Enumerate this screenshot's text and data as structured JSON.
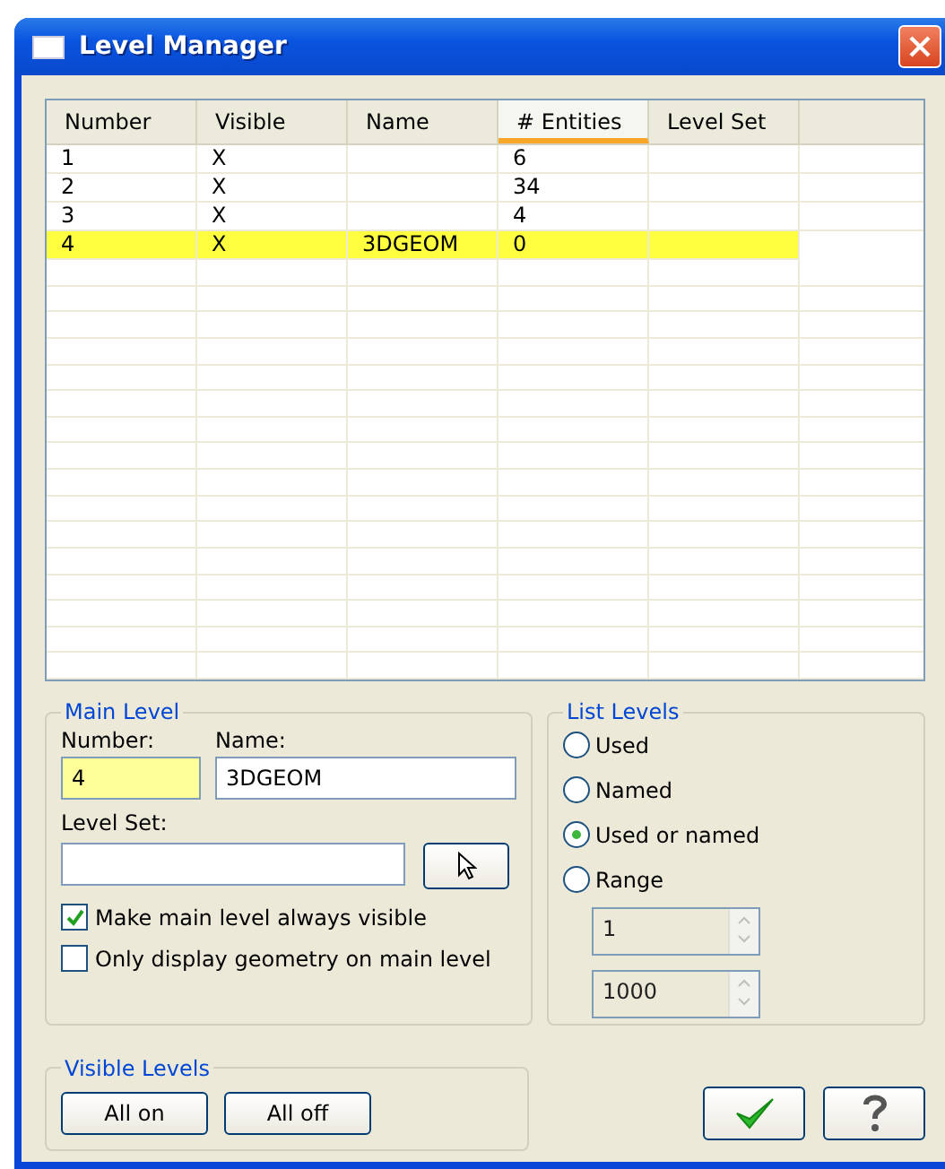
{
  "window": {
    "title": "Level Manager"
  },
  "table": {
    "columns": [
      {
        "label": "Number",
        "sorted": false
      },
      {
        "label": "Visible",
        "sorted": false
      },
      {
        "label": "Name",
        "sorted": false
      },
      {
        "label": "# Entities",
        "sorted": true
      },
      {
        "label": "Level Set",
        "sorted": false
      }
    ],
    "rows": [
      {
        "cells": [
          "1",
          "X",
          "",
          "6",
          ""
        ],
        "selected": false
      },
      {
        "cells": [
          "2",
          "X",
          "",
          "34",
          ""
        ],
        "selected": false
      },
      {
        "cells": [
          "3",
          "X",
          "",
          "4",
          ""
        ],
        "selected": false
      },
      {
        "cells": [
          "4",
          "X",
          "3DGEOM",
          "0",
          ""
        ],
        "selected": true
      }
    ]
  },
  "main_level": {
    "title": "Main Level",
    "number_label": "Number:",
    "number_value": "4",
    "name_label": "Name:",
    "name_value": "3DGEOM",
    "level_set_label": "Level Set:",
    "checkboxes": [
      {
        "label": "Make main level always visible",
        "checked": true
      },
      {
        "label": "Only display geometry on main level",
        "checked": false
      }
    ]
  },
  "list_levels": {
    "title": "List Levels",
    "options": [
      {
        "label": "Used",
        "selected": false
      },
      {
        "label": "Named",
        "selected": false
      },
      {
        "label": "Used or named",
        "selected": true
      },
      {
        "label": "Range",
        "selected": false
      }
    ],
    "range_fields": [
      {
        "value": "1",
        "disabled": true
      },
      {
        "value": "1000",
        "disabled": true
      }
    ]
  },
  "visible_levels": {
    "title": "Visible Levels",
    "buttons": [
      "All on",
      "All off"
    ]
  }
}
